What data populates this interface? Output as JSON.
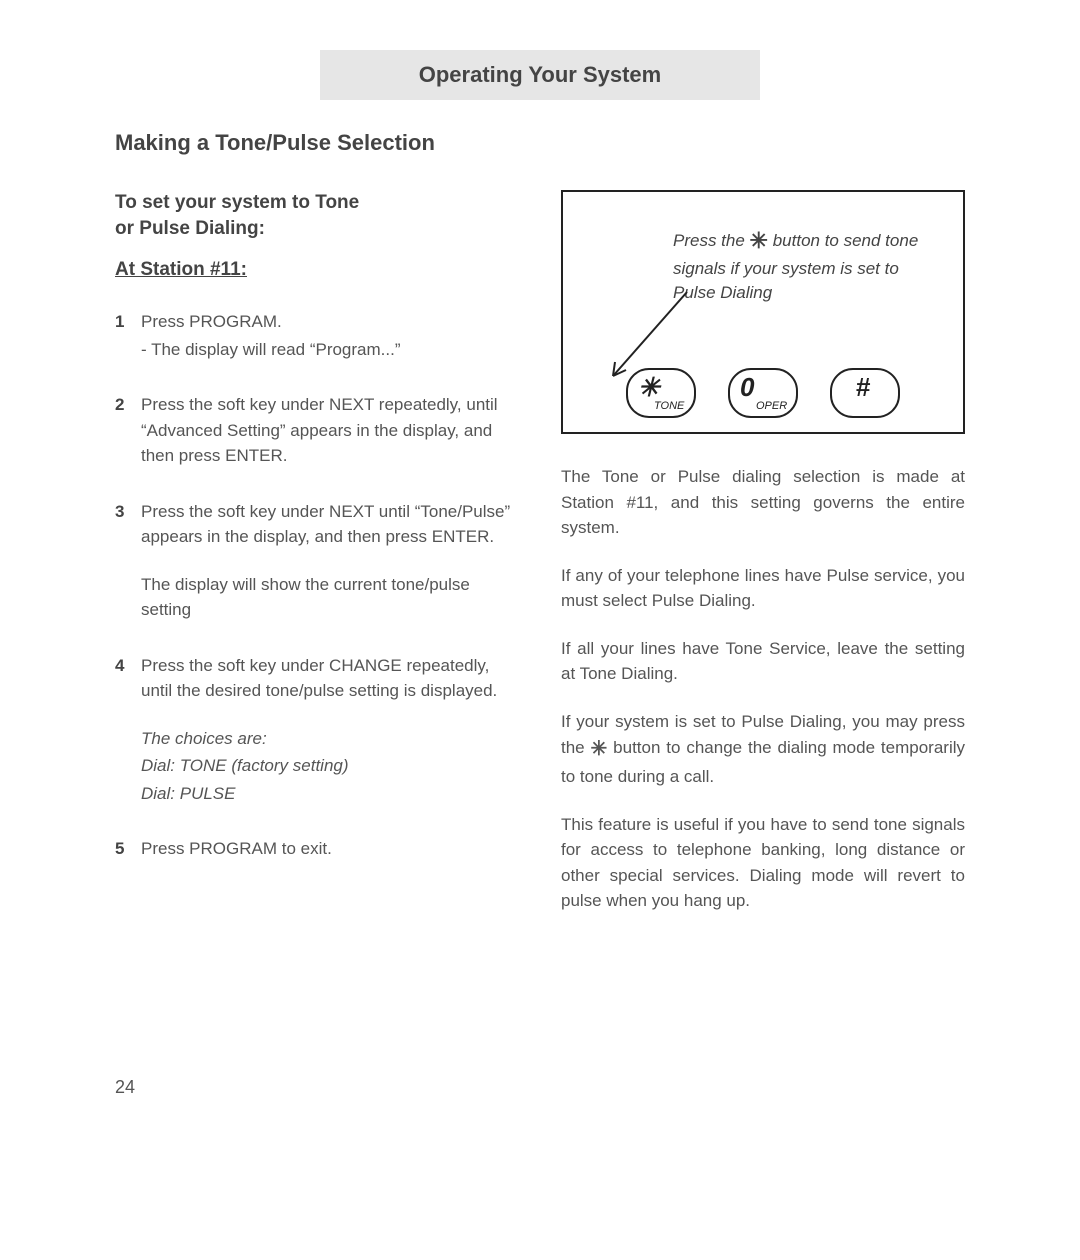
{
  "header": "Operating Your System",
  "section_title": "Making a Tone/Pulse Selection",
  "left": {
    "subhead_l1": "To set your system to Tone",
    "subhead_l2": "or Pulse Dialing:",
    "station": "At Station #11:",
    "steps": {
      "s1_a": "Press PROGRAM.",
      "s1_b": "- The display will read “Program...”",
      "s2": "Press the soft key under NEXT repeatedly, until “Advanced Setting” appears in the display, and then press ENTER.",
      "s3_a": "Press the soft key under NEXT until “Tone/Pulse” appears in the display, and then press ENTER.",
      "s3_b": "The display will show the current tone/pulse setting",
      "s4_a": "Press the soft key under CHANGE repeatedly, until the desired tone/pulse setting is displayed.",
      "s4_b": "The choices are:",
      "s4_c": "Dial: TONE (factory setting)",
      "s4_d": "Dial: PULSE",
      "s5": "Press PROGRAM to exit."
    }
  },
  "right": {
    "diagram": {
      "caption_pre": "Press the ",
      "caption_star": "✳",
      "caption_post": " button to send tone signals if your system is set to Pulse Dialing",
      "key_star": "✳",
      "key_star_sub": "TONE",
      "key_zero": "0",
      "key_zero_sub": "OPER",
      "key_hash": "#"
    },
    "p1": "The Tone or Pulse dialing selection is made at Station #11, and this setting governs the entire system.",
    "p2": "If any of your telephone lines have Pulse service, you must select Pulse Dialing.",
    "p3": "If all your lines have Tone Service, leave the setting at Tone Dialing.",
    "p4_pre": "If your system is set to Pulse Dialing, you may press the ",
    "p4_star": "✳",
    "p4_post": " button to change the dialing mode temporarily to tone during a call.",
    "p5": "This feature is useful if you have to send tone signals for access to telephone banking, long distance or other special services.  Dialing mode will revert to pulse when you hang up."
  },
  "page_number": "24"
}
